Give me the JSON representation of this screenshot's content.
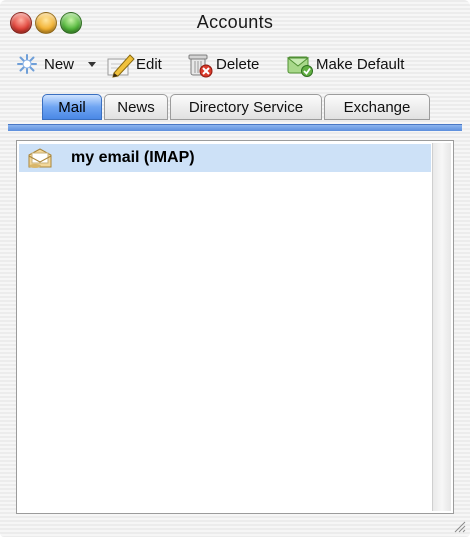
{
  "window": {
    "title": "Accounts"
  },
  "toolbar": {
    "new_label": "New",
    "edit_label": "Edit",
    "delete_label": "Delete",
    "make_default_label": "Make Default"
  },
  "tabs": [
    {
      "label": "Mail",
      "selected": true
    },
    {
      "label": "News",
      "selected": false
    },
    {
      "label": "Directory Service",
      "selected": false
    },
    {
      "label": "Exchange",
      "selected": false
    }
  ],
  "accounts": [
    {
      "label": "my email (IMAP)",
      "selected": true,
      "icon": "mail-account-icon"
    }
  ],
  "colors": {
    "selected_tab": "#4a88e6",
    "selected_row": "#cde1f7"
  }
}
